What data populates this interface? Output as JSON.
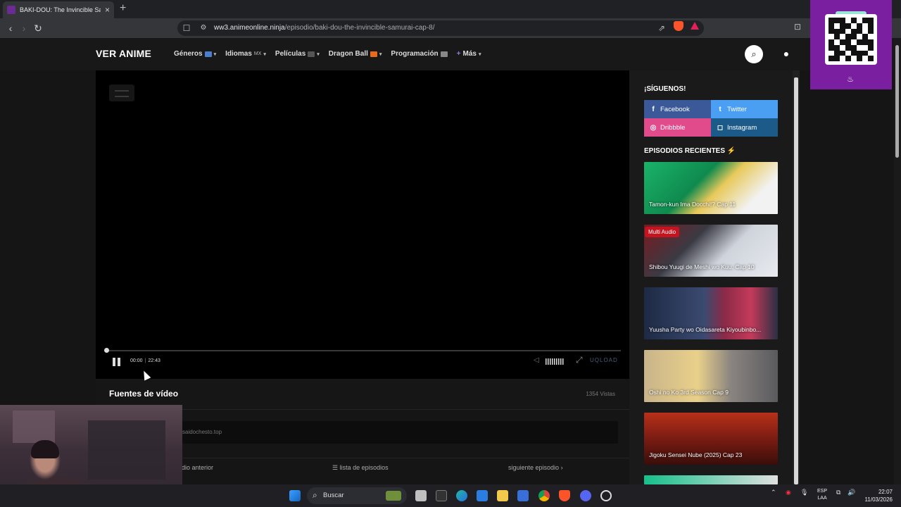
{
  "browser": {
    "tab_title": "BAKI-DOU: The Invincible Samurai",
    "tab_close": "×",
    "new_tab": "+",
    "url_host": "ww3.animeonline.ninja",
    "url_path": "/episodio/baki-dou-the-invincible-samurai-cap-8/",
    "back": "‹",
    "forward": "›",
    "reload": "↻"
  },
  "site": {
    "logo": "VER ANIME",
    "nav": [
      {
        "label": "Géneros"
      },
      {
        "label": "Idiomas",
        "suffix": "MX"
      },
      {
        "label": "Películas"
      },
      {
        "label": "Dragon Ball"
      },
      {
        "label": "Programación"
      },
      {
        "label": "Más",
        "prefix": "+"
      }
    ]
  },
  "player": {
    "current_time": "00:00",
    "duration": "22:43",
    "progress_fraction": 0.0,
    "brand": "UQLOAD"
  },
  "sources": {
    "title": "Fuentes de vídeo",
    "views": "1354 Vistas",
    "source_text": "saidochesto.top"
  },
  "episode_nav": {
    "prev": "dio anterior",
    "list": "lista de episodios",
    "next": "siguiente episodio"
  },
  "sidebar": {
    "follow_title": "¡SÍGUENOS!",
    "social": [
      {
        "label": "Facebook",
        "icon": "f",
        "color": "#3b5998"
      },
      {
        "label": "Twitter",
        "icon": "t",
        "color": "#4a9ff2"
      },
      {
        "label": "Dribbble",
        "icon": "◎",
        "color": "#e24b8b"
      },
      {
        "label": "Instagram",
        "icon": "◻",
        "color": "#1c5a8a"
      }
    ],
    "recent_title": "EPISODIOS RECIENTES",
    "recent_emoji": "⚡",
    "episodes": [
      {
        "label": "Tamon-kun Ima Docchi!? Cap 11",
        "badge": ""
      },
      {
        "label": "Shibou Yuugi de Meshi wo Kuu. Cap 10",
        "badge": "Multi Audio"
      },
      {
        "label": "Yuusha Party wo Oidasareta Kiyoubinbo...",
        "badge": ""
      },
      {
        "label": "Oshi no Ko 3rd Season Cap 9",
        "badge": ""
      },
      {
        "label": "Jigoku Sensei Nube (2025) Cap 23",
        "badge": ""
      }
    ]
  },
  "taskbar": {
    "search_placeholder": "Buscar",
    "lang_top": "ESP",
    "lang_bottom": "LAA",
    "time": "22:07",
    "date": "11/03/2026"
  },
  "colors": {
    "accent_purple": "#7a1fa0",
    "badge_red": "#c31420"
  }
}
